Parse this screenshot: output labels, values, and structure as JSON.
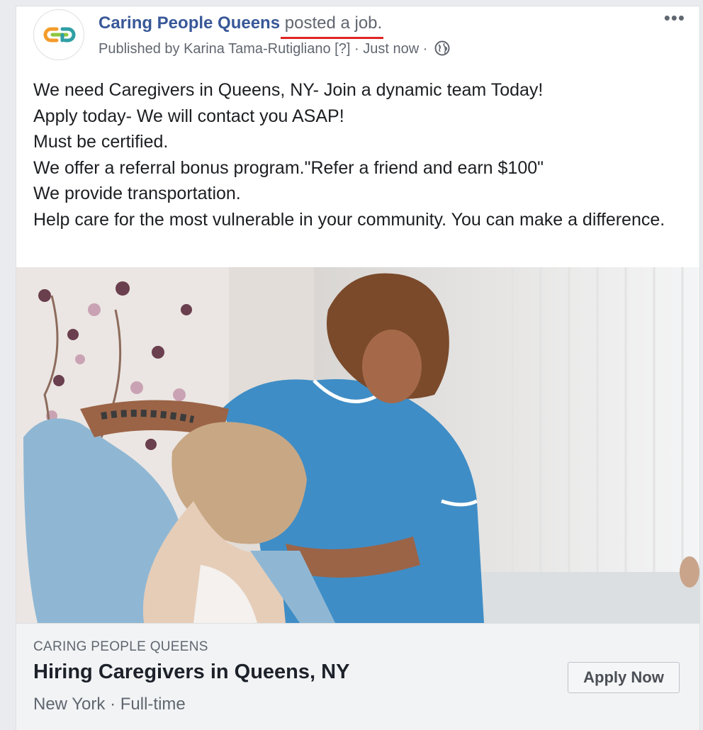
{
  "post": {
    "page_name": "Caring People Queens",
    "action_text": "posted a job.",
    "published_by": "Published by Karina Tama-Rutigliano",
    "help_marker": "[?]",
    "separator": "·",
    "timestamp": "Just now",
    "more_label": "•••",
    "body_lines": [
      "We need Caregivers in Queens, NY- Join a dynamic team Today!",
      "Apply today- We will contact you ASAP!",
      "Must be certified.",
      "We offer a referral bonus program.\"Refer a friend and earn $100\"",
      "We provide transportation.",
      "Help care for the most vulnerable in your community. You can make a difference."
    ],
    "icons": {
      "avatar": "caring-people-logo",
      "audience": "globe-icon",
      "menu": "more-options-icon"
    },
    "colors": {
      "page_name": "#385898",
      "underline": "#e02424",
      "logo_orange": "#f39c2b",
      "logo_teal": "#2f9fa4",
      "logo_green": "#8cc63f"
    }
  },
  "job_card": {
    "source": "CARING PEOPLE QUEENS",
    "title": "Hiring Caregivers in Queens, NY",
    "location": "New York",
    "type": "Full-time",
    "separator": "·",
    "button_label": "Apply Now"
  }
}
